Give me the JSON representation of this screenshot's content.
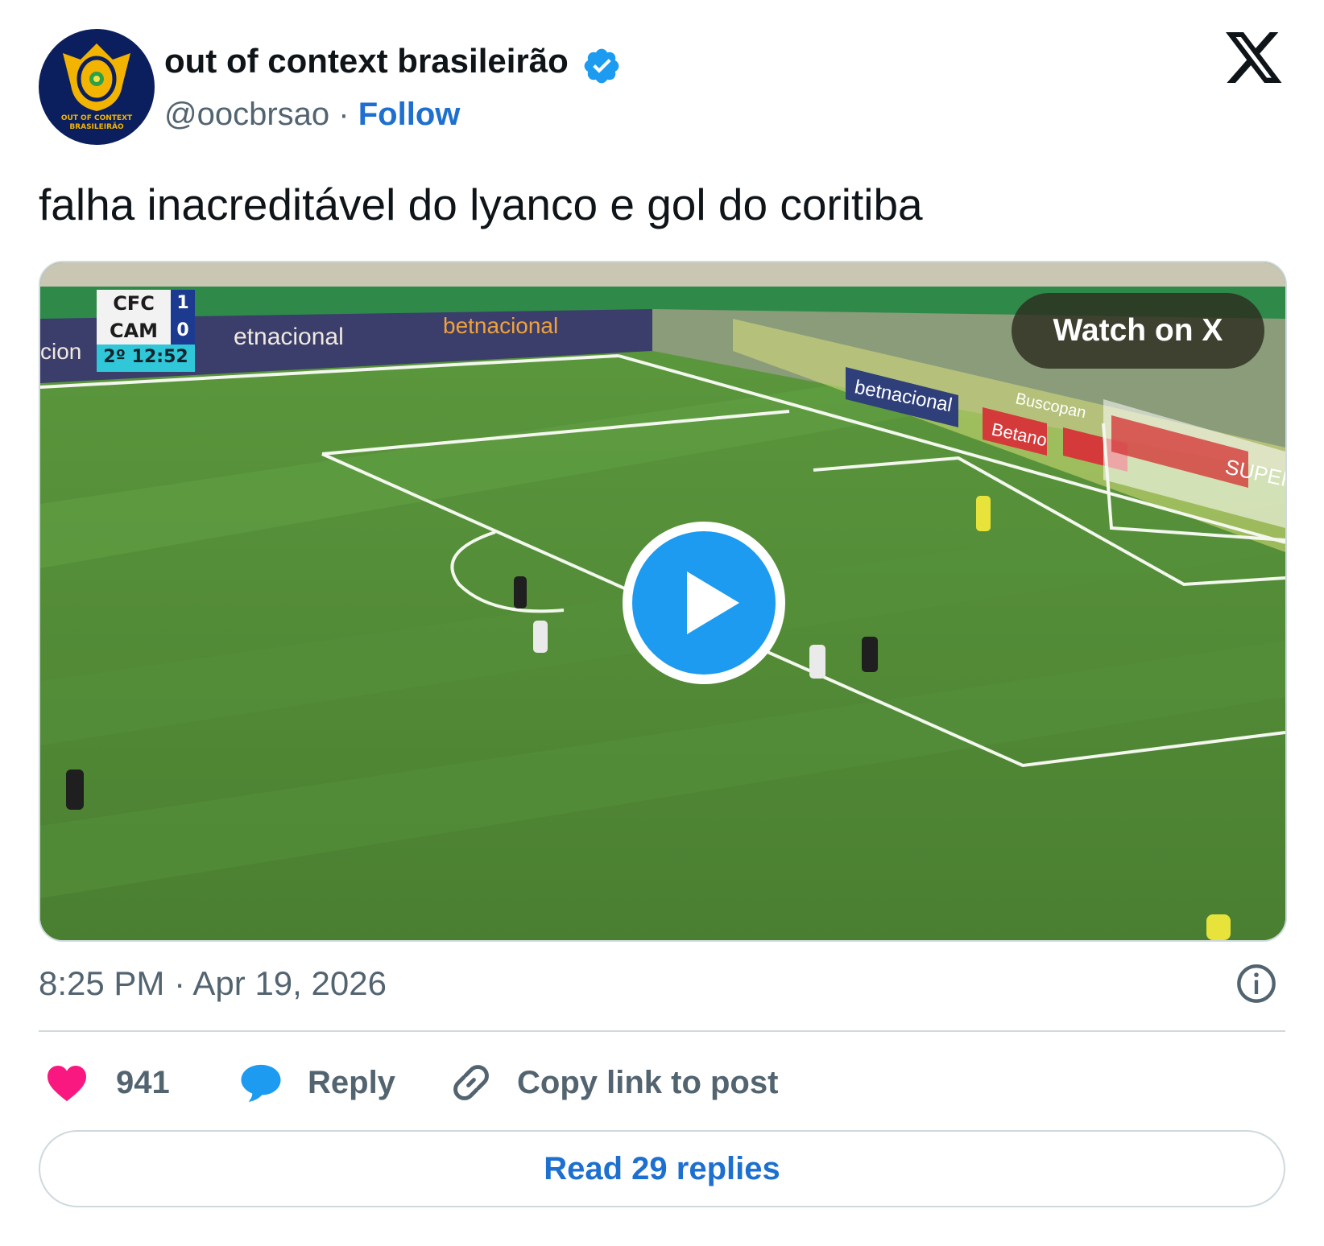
{
  "author": {
    "avatar_text": [
      "OUT OF CONTEXT",
      "BRASILEIRÃO"
    ],
    "display_name": "out of context brasileirão",
    "handle": "@oocbrsao",
    "separator": "·",
    "follow_label": "Follow",
    "verified": true
  },
  "tweet": {
    "text": "falha inacreditável do lyanco e gol do coritiba"
  },
  "media": {
    "scoreboard": {
      "home_team": "CFC",
      "home_score": "1",
      "away_team": "CAM",
      "away_score": "0",
      "clock": "2º 12:52"
    },
    "watch_label": "Watch on X",
    "ad_boards": [
      "cion",
      "betnacional",
      "betnacional",
      "betnacional",
      "Buscopan",
      "Buscopan",
      "Betano",
      "Betano",
      "SUPER"
    ]
  },
  "meta": {
    "timestamp": "8:25 PM · Apr 19, 2026"
  },
  "actions": {
    "likes": "941",
    "reply_label": "Reply",
    "copy_label": "Copy link to post",
    "read_replies_label": "Read 29 replies"
  },
  "colors": {
    "accent": "#1d9bf0",
    "link": "#1d6fd0",
    "heart": "#f91880",
    "muted": "#536471",
    "text": "#0f1419"
  },
  "icons": {
    "verified": "verified-badge-icon",
    "brand": "x-logo-icon",
    "play": "play-icon",
    "info": "info-icon",
    "like": "heart-icon",
    "reply": "speech-bubble-icon",
    "copy": "link-icon"
  }
}
